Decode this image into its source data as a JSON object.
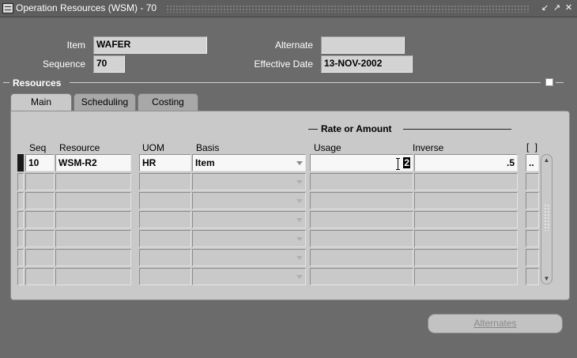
{
  "window": {
    "title": "Operation Resources (WSM) - 70",
    "buttons": [
      "minimize-icon",
      "maximize-icon",
      "close-icon"
    ]
  },
  "header": {
    "item_label": "Item",
    "item_value": "WAFER",
    "alternate_label": "Alternate",
    "alternate_value": "",
    "sequence_label": "Sequence",
    "sequence_value": "70",
    "effective_date_label": "Effective Date",
    "effective_date_value": "13-NOV-2002"
  },
  "resources": {
    "section_title": "Resources",
    "tabs": [
      {
        "label": "Main",
        "active": true
      },
      {
        "label": "Scheduling",
        "active": false
      },
      {
        "label": "Costing",
        "active": false
      }
    ],
    "rate_group_label": "Rate or Amount",
    "columns": {
      "seq": "Seq",
      "resource": "Resource",
      "uom": "UOM",
      "basis": "Basis",
      "usage": "Usage",
      "inverse": "Inverse",
      "dflex": "[ ]"
    },
    "rows": [
      {
        "seq": "10",
        "resource": "WSM-R2",
        "uom": "HR",
        "basis": "Item",
        "usage": "2",
        "inverse": ".5",
        "dflex": ".."
      },
      {
        "seq": "",
        "resource": "",
        "uom": "",
        "basis": "",
        "usage": "",
        "inverse": "",
        "dflex": ""
      },
      {
        "seq": "",
        "resource": "",
        "uom": "",
        "basis": "",
        "usage": "",
        "inverse": "",
        "dflex": ""
      },
      {
        "seq": "",
        "resource": "",
        "uom": "",
        "basis": "",
        "usage": "",
        "inverse": "",
        "dflex": ""
      },
      {
        "seq": "",
        "resource": "",
        "uom": "",
        "basis": "",
        "usage": "",
        "inverse": "",
        "dflex": ""
      },
      {
        "seq": "",
        "resource": "",
        "uom": "",
        "basis": "",
        "usage": "",
        "inverse": "",
        "dflex": ""
      },
      {
        "seq": "",
        "resource": "",
        "uom": "",
        "basis": "",
        "usage": "",
        "inverse": "",
        "dflex": ""
      }
    ]
  },
  "footer": {
    "alternates_button": "Alternates",
    "alternates_enabled": false
  },
  "colors": {
    "background": "#6b6b6b",
    "panel": "#c9c9c9",
    "field": "#d3d3d3",
    "active_field": "#f7f7f7"
  }
}
